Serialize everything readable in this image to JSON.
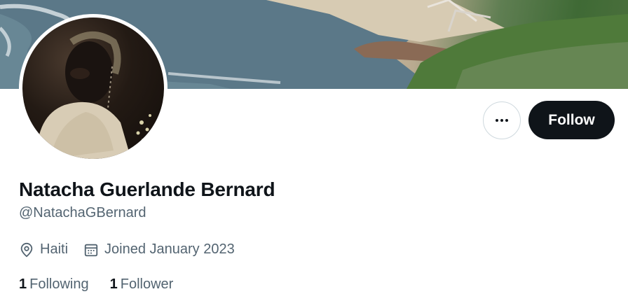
{
  "profile": {
    "name": "Natacha Guerlande Bernard",
    "handle": "@NatachaGBernard",
    "location": "Haiti",
    "joined": "Joined January 2023"
  },
  "actions": {
    "more_icon": "more-horizontal-icon",
    "follow_label": "Follow"
  },
  "stats": {
    "following_count": "1",
    "following_label": "Following",
    "followers_count": "1",
    "followers_label": "Follower"
  },
  "icons": {
    "location": "location-pin-icon",
    "joined": "calendar-icon"
  },
  "colors": {
    "primary_text": "#0f1419",
    "secondary_text": "#536471",
    "follow_button_bg": "#0f1419",
    "border": "#cfd9de"
  }
}
